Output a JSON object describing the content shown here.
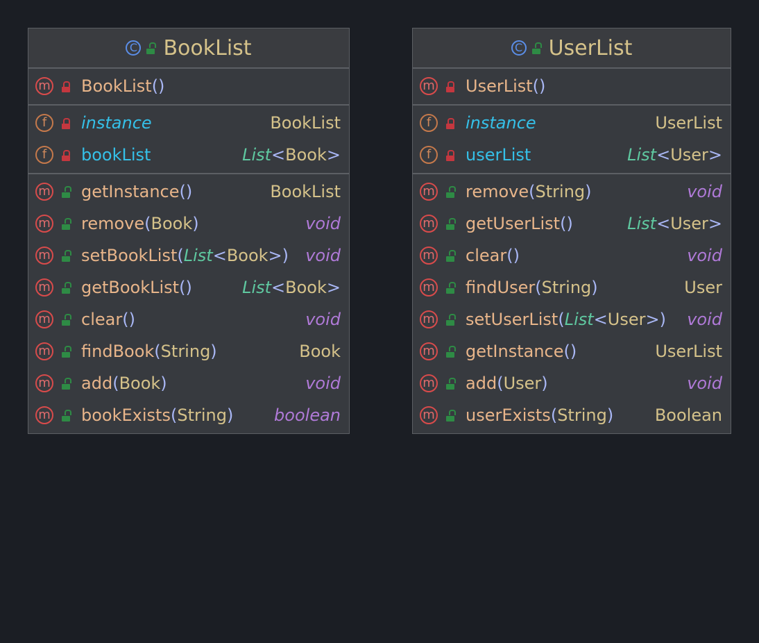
{
  "classes": [
    {
      "name": "BookList",
      "constructors": [
        {
          "name": "BookList",
          "params": "()"
        }
      ],
      "fields": [
        {
          "name": "instance",
          "static": true,
          "type": "BookList",
          "type_kind": "type"
        },
        {
          "name": "bookList",
          "static": false,
          "type_generic": "List",
          "type_inner": "Book",
          "type_kind": "generic"
        }
      ],
      "methods": [
        {
          "name": "getInstance",
          "params": "()",
          "ret": "BookList",
          "ret_kind": "type"
        },
        {
          "name": "remove",
          "param_inner": "Book",
          "ret": "void",
          "ret_kind": "kw"
        },
        {
          "name": "setBookList",
          "param_generic": "List",
          "param_inner": "Book",
          "ret": "void",
          "ret_kind": "kw"
        },
        {
          "name": "getBookList",
          "params": "()",
          "ret_generic": "List",
          "ret_inner": "Book",
          "ret_kind": "generic"
        },
        {
          "name": "clear",
          "params": "()",
          "ret": "void",
          "ret_kind": "kw"
        },
        {
          "name": "findBook",
          "param_inner": "String",
          "ret": "Book",
          "ret_kind": "type"
        },
        {
          "name": "add",
          "param_inner": "Book",
          "ret": "void",
          "ret_kind": "kw"
        },
        {
          "name": "bookExists",
          "param_inner": "String",
          "ret": "boolean",
          "ret_kind": "kw"
        }
      ]
    },
    {
      "name": "UserList",
      "constructors": [
        {
          "name": "UserList",
          "params": "()"
        }
      ],
      "fields": [
        {
          "name": "instance",
          "static": true,
          "type": "UserList",
          "type_kind": "type"
        },
        {
          "name": "userList",
          "static": false,
          "type_generic": "List",
          "type_inner": "User",
          "type_kind": "generic"
        }
      ],
      "methods": [
        {
          "name": "remove",
          "param_inner": "String",
          "ret": "void",
          "ret_kind": "kw"
        },
        {
          "name": "getUserList",
          "params": "()",
          "ret_generic": "List",
          "ret_inner": "User",
          "ret_kind": "generic"
        },
        {
          "name": "clear",
          "params": "()",
          "ret": "void",
          "ret_kind": "kw"
        },
        {
          "name": "findUser",
          "param_inner": "String",
          "ret": "User",
          "ret_kind": "type"
        },
        {
          "name": "setUserList",
          "param_generic": "List",
          "param_inner": "User",
          "ret": "void",
          "ret_kind": "kw"
        },
        {
          "name": "getInstance",
          "params": "()",
          "ret": "UserList",
          "ret_kind": "type"
        },
        {
          "name": "add",
          "param_inner": "User",
          "ret": "void",
          "ret_kind": "kw"
        },
        {
          "name": "userExists",
          "param_inner": "String",
          "ret": "Boolean",
          "ret_kind": "type"
        }
      ]
    }
  ],
  "icons": {
    "class_icon": "class-c-icon",
    "method_icon": "method-m-icon",
    "field_icon": "field-f-icon",
    "private_icon": "private-lock-icon",
    "public_icon": "public-unlock-icon",
    "class_glyph": "C",
    "method_glyph": "m",
    "field_glyph": "f"
  },
  "colors": {
    "background": "#1b1e24",
    "box": "#373a3f",
    "method_name": "#e8b58a",
    "field_name": "#35c0e8",
    "type": "#d5c28a",
    "keyword": "#b07ad8",
    "generic": "#5fc8a0"
  }
}
